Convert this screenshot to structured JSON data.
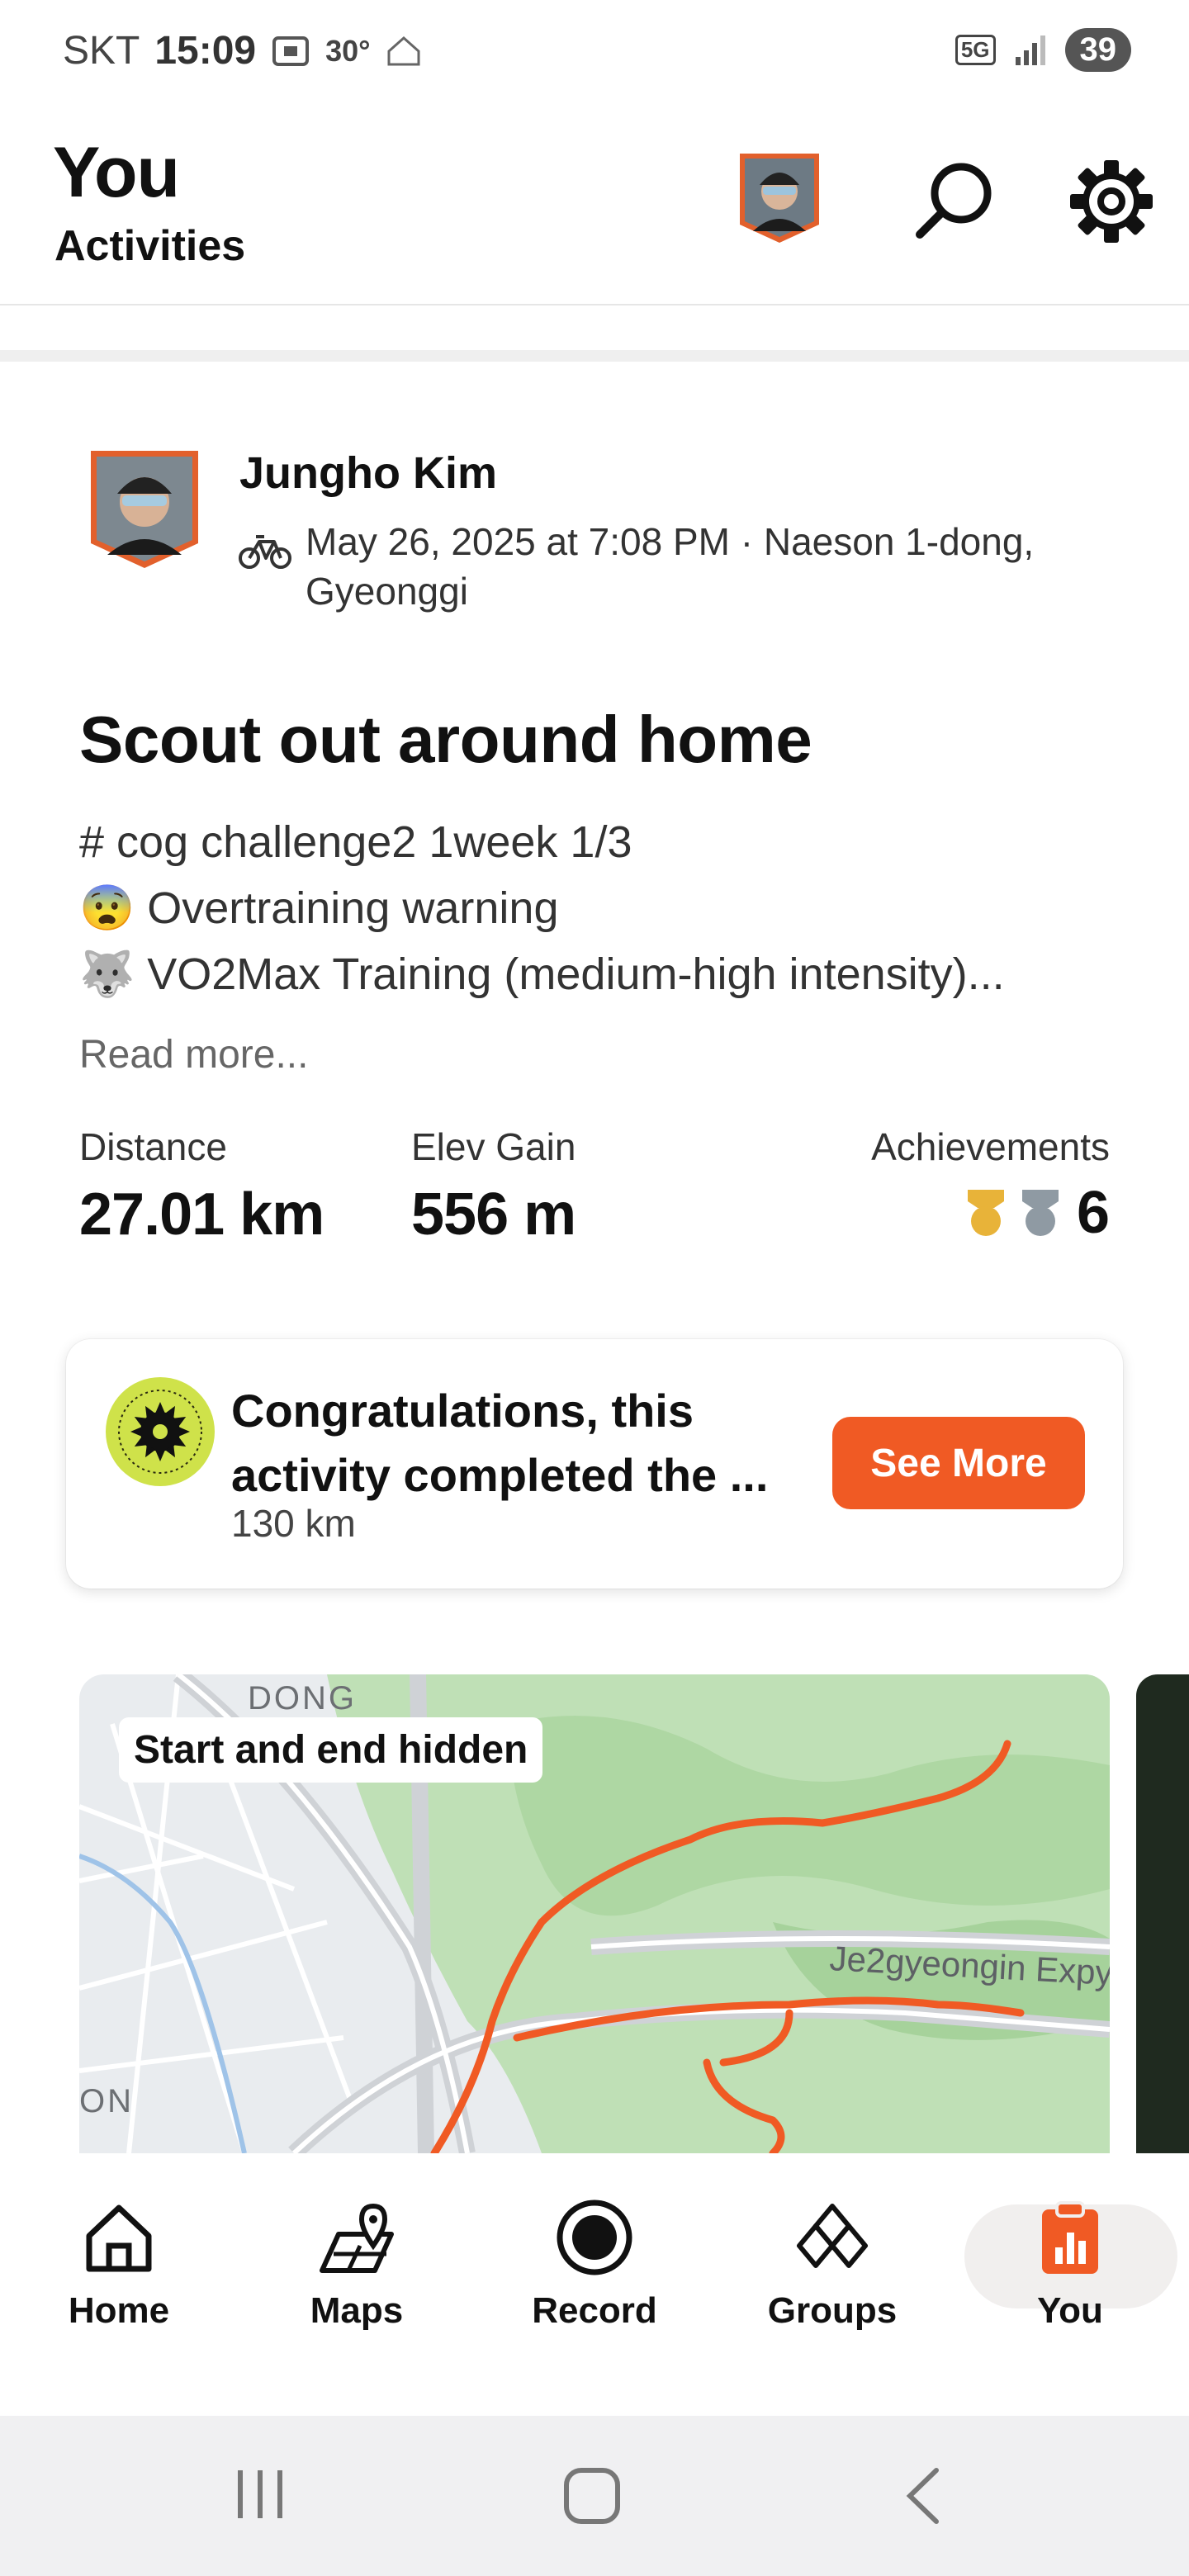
{
  "status_bar": {
    "carrier": "SKT",
    "time": "15:09",
    "temperature": "30°",
    "network": "5G",
    "battery": "39"
  },
  "header": {
    "title": "You",
    "subtitle": "Activities"
  },
  "activity": {
    "author": "Jungho Kim",
    "sport_icon": "bicycle-icon",
    "meta": "May 26, 2025 at 7:08 PM · Naeson 1-dong, Gyeonggi",
    "title": "Scout out around home",
    "description_lines": [
      "# cog challenge2  1week 1/3",
      "😨 Overtraining warning",
      "🐺 VO2Max Training (medium-high intensity)..."
    ],
    "read_more": "Read more...",
    "stats": {
      "distance_label": "Distance",
      "distance_value": "27.01 km",
      "elev_label": "Elev Gain",
      "elev_value": "556 m",
      "achievements_label": "Achievements",
      "achievements_count": "6"
    }
  },
  "challenge_card": {
    "title": "Congratulations, this activity completed the ...",
    "subtitle": "130 km",
    "button": "See More"
  },
  "map": {
    "chip": "Start and end hidden",
    "labels": {
      "district": "DONG",
      "road": "Je2gyeongin Expy",
      "edge": "ON"
    },
    "route_color": "#f05a24"
  },
  "bottom_nav": {
    "items": [
      {
        "label": "Home",
        "icon": "home-icon"
      },
      {
        "label": "Maps",
        "icon": "maps-icon"
      },
      {
        "label": "Record",
        "icon": "record-icon"
      },
      {
        "label": "Groups",
        "icon": "groups-icon"
      },
      {
        "label": "You",
        "icon": "you-icon"
      }
    ],
    "active": "You",
    "accent": "#f05a24"
  }
}
